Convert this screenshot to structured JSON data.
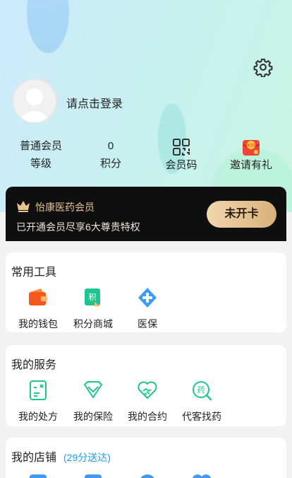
{
  "header": {
    "login_prompt": "请点击登录",
    "stats": [
      {
        "value": "普通会员",
        "label": "等级"
      },
      {
        "value": "0",
        "label": "积分"
      },
      {
        "icon": "qr-code-icon",
        "label": "会员码"
      },
      {
        "icon": "red-packet-icon",
        "label": "邀请有礼"
      }
    ]
  },
  "vip": {
    "title": "怡康医药会员",
    "subtitle": "已开通会员尽享6大尊贵特权",
    "button": "未开卡"
  },
  "tools": {
    "title": "常用工具",
    "items": [
      {
        "label": "我的钱包",
        "icon": "wallet-icon"
      },
      {
        "label": "积分商城",
        "icon": "points-mall-icon"
      },
      {
        "label": "医保",
        "icon": "medical-insurance-icon"
      }
    ]
  },
  "services": {
    "title": "我的服务",
    "items": [
      {
        "label": "我的处方",
        "icon": "prescription-icon"
      },
      {
        "label": "我的保险",
        "icon": "insurance-icon"
      },
      {
        "label": "我的合约",
        "icon": "contract-icon"
      },
      {
        "label": "代客找药",
        "icon": "find-medicine-icon"
      }
    ]
  },
  "store": {
    "title": "我的店铺",
    "hint": "(29分送达)"
  },
  "colors": {
    "accent_green": "#1fc58f",
    "vip_gold": "#e7c48f",
    "hint_blue": "#1ba0e8"
  }
}
